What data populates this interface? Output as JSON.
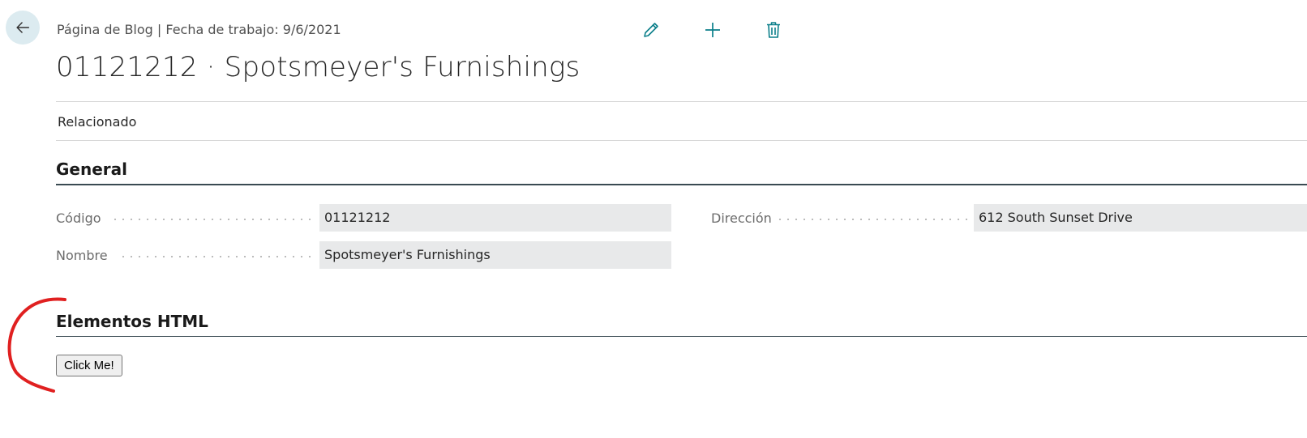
{
  "header": {
    "caption": "Página de Blog | Fecha de trabajo: 9/6/2021",
    "record_title": "01121212 · Spotsmeyer's Furnishings",
    "back_icon": "arrow-left-icon",
    "actions": [
      {
        "name": "edit",
        "icon": "pencil-icon"
      },
      {
        "name": "new",
        "icon": "plus-icon"
      },
      {
        "name": "delete",
        "icon": "trash-icon"
      }
    ],
    "accent_color": "#0b7f8a"
  },
  "menu": {
    "related_label": "Relacionado"
  },
  "general": {
    "title": "General",
    "fields": {
      "codigo": {
        "label": "Código",
        "value": "01121212"
      },
      "nombre": {
        "label": "Nombre",
        "value": "Spotsmeyer's Furnishings"
      },
      "direccion": {
        "label": "Dirección",
        "value": "612 South Sunset Drive"
      }
    }
  },
  "html_elements": {
    "title": "Elementos HTML",
    "button_label": "Click Me!"
  },
  "annotation": {
    "color": "#e02020"
  }
}
